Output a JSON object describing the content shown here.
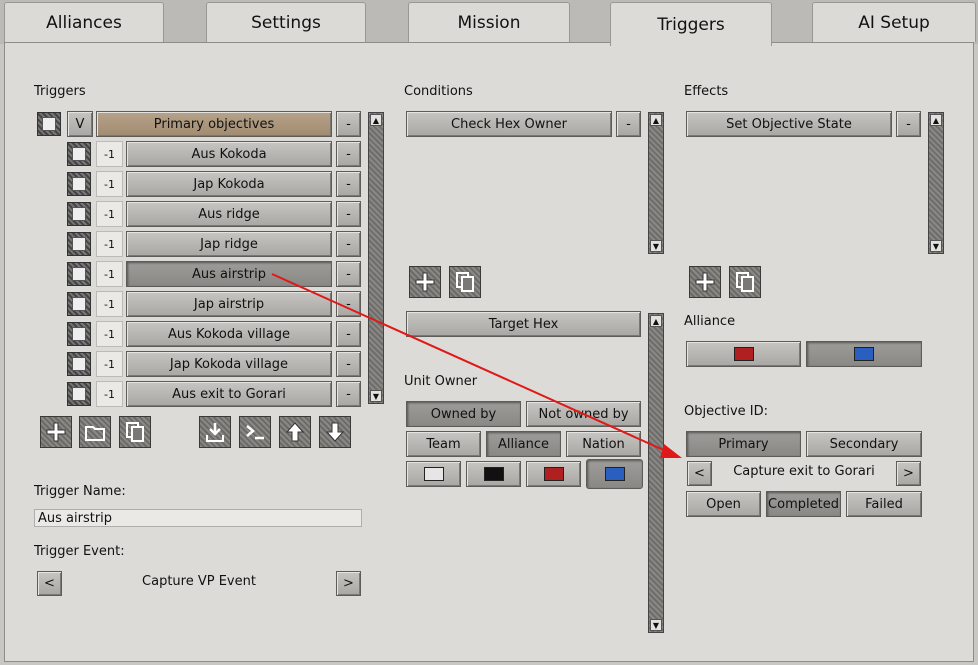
{
  "tabs": [
    "Alliances",
    "Settings",
    "Mission",
    "Triggers",
    "AI Setup"
  ],
  "triggers": {
    "title": "Triggers",
    "header_toggle": "V",
    "header_label": "Primary objectives",
    "remove_label": "-",
    "items": [
      {
        "priority": "-1",
        "label": "Aus Kokoda"
      },
      {
        "priority": "-1",
        "label": "Jap Kokoda"
      },
      {
        "priority": "-1",
        "label": "Aus ridge"
      },
      {
        "priority": "-1",
        "label": "Jap ridge"
      },
      {
        "priority": "-1",
        "label": "Aus airstrip"
      },
      {
        "priority": "-1",
        "label": "Jap airstrip"
      },
      {
        "priority": "-1",
        "label": "Aus Kokoda village"
      },
      {
        "priority": "-1",
        "label": "Jap Kokoda village"
      },
      {
        "priority": "-1",
        "label": "Aus exit to Gorari"
      }
    ],
    "name_label": "Trigger Name:",
    "name_value": "Aus airstrip",
    "event_label": "Trigger Event:",
    "event_value": "Capture VP Event",
    "prev": "<",
    "next": ">"
  },
  "conditions": {
    "title": "Conditions",
    "item": "Check Hex Owner",
    "remove_label": "-",
    "target_hex": "Target Hex",
    "unit_owner_label": "Unit Owner",
    "owned_by": "Owned by",
    "not_owned_by": "Not owned by",
    "team": "Team",
    "alliance": "Alliance",
    "nation": "Nation",
    "colors": [
      "#e6e6e6",
      "#111111",
      "#b02020",
      "#2a5fc0"
    ]
  },
  "effects": {
    "title": "Effects",
    "item": "Set Objective State",
    "remove_label": "-",
    "alliance_label": "Alliance",
    "alliance_colors": [
      "#b02020",
      "#2a5fc0"
    ],
    "objective_label": "Objective ID:",
    "primary": "Primary",
    "secondary": "Secondary",
    "objective_value": "Capture exit to Gorari",
    "prev": "<",
    "next": ">",
    "open": "Open",
    "completed": "Completed",
    "failed": "Failed"
  }
}
